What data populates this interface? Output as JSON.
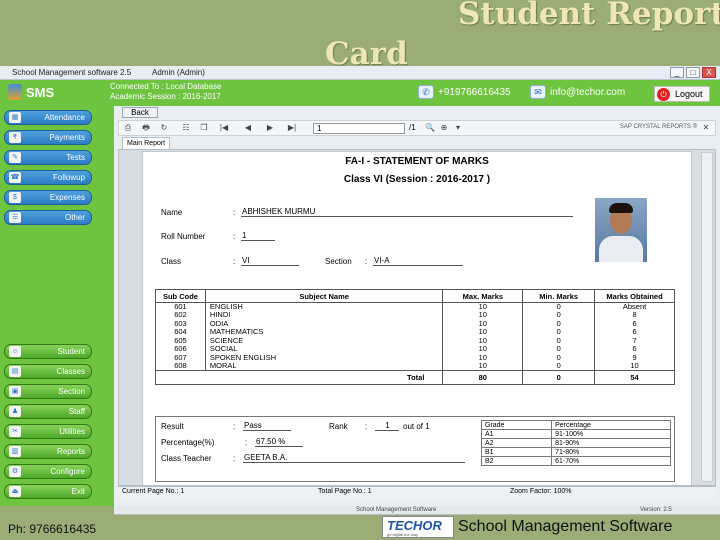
{
  "slide": {
    "title_line1": "Student Report",
    "title_line2": "Card",
    "footer_phone": "Ph: 9766616435",
    "footer_logo": "TECHOR",
    "footer_logo_tagline": "go digital the way",
    "footer_product": "School Management Software"
  },
  "window": {
    "title": "School Management software 2.5",
    "user": "Admin (Admin)",
    "btn_min": "_",
    "btn_max": "□",
    "btn_close": "X"
  },
  "header": {
    "logo_text": "SMS",
    "connection": "Connected To : Local Database",
    "session": "Academic Session : 2016-2017",
    "phone": "+919766616435",
    "email": "info@techor.com",
    "logout": "Logout"
  },
  "sidebar": {
    "top": [
      {
        "label": "Attendance",
        "icon": "calendar-icon"
      },
      {
        "label": "Payments",
        "icon": "payments-icon"
      },
      {
        "label": "Tests",
        "icon": "tests-icon"
      },
      {
        "label": "Followup",
        "icon": "followup-icon"
      },
      {
        "label": "Expenses",
        "icon": "expenses-icon"
      },
      {
        "label": "Other",
        "icon": "other-icon"
      }
    ],
    "bottom": [
      {
        "label": "Student",
        "icon": "student-icon"
      },
      {
        "label": "Classes",
        "icon": "classes-icon"
      },
      {
        "label": "Section",
        "icon": "section-icon"
      },
      {
        "label": "Staff",
        "icon": "staff-icon"
      },
      {
        "label": "Utilities",
        "icon": "utilities-icon"
      },
      {
        "label": "Reports",
        "icon": "reports-icon"
      },
      {
        "label": "Configure",
        "icon": "configure-icon"
      },
      {
        "label": "Exit",
        "icon": "exit-icon"
      }
    ]
  },
  "viewer": {
    "back": "Back",
    "page_input": "1",
    "page_count": "/1",
    "brand": "SAP CRYSTAL REPORTS ®",
    "tab": "Main Report",
    "status_current": "Current Page No.: 1",
    "status_total": "Total Page No.: 1",
    "status_zoom": "Zoom Factor: 100%"
  },
  "report": {
    "title": "FA-I  - STATEMENT OF MARKS",
    "subtitle": "Class VI (Session : 2016-2017 )",
    "name_label": "Name",
    "name": "ABHISHEK  MURMU",
    "roll_label": "Roll Number",
    "roll": "1",
    "class_label": "Class",
    "class": "VI",
    "section_label": "Section",
    "section": "VI-A",
    "colon": ":",
    "headers": [
      "Sub Code",
      "Subject Name",
      "Max. Marks",
      "Min. Marks",
      "Marks Obtained"
    ],
    "rows": [
      [
        "601",
        "ENGLISH",
        "10",
        "0",
        "Absent"
      ],
      [
        "602",
        "HINDI",
        "10",
        "0",
        "8"
      ],
      [
        "603",
        "ODIA",
        "10",
        "0",
        "6"
      ],
      [
        "604",
        "MATHEMATICS",
        "10",
        "0",
        "6"
      ],
      [
        "605",
        "SCIENCE",
        "10",
        "0",
        "7"
      ],
      [
        "606",
        "SOCIAL",
        "10",
        "0",
        "6"
      ],
      [
        "607",
        "SPOKEN ENGLISH",
        "10",
        "0",
        "9"
      ],
      [
        "608",
        "MORAL",
        "10",
        "0",
        "10"
      ]
    ],
    "total_label": "Total",
    "total_max": "80",
    "total_min": "0",
    "total_obtained": "54",
    "result_label": "Result",
    "result": "Pass",
    "rank_label": "Rank",
    "rank": "1",
    "rank_of": "out of 1",
    "percentage_label": "Percentage(%)",
    "percentage": "67.50 %",
    "teacher_label": "Class Teacher",
    "teacher": "GEETA B.A.",
    "grade_header": "Grade",
    "perc_header": "Percentage",
    "grades": [
      [
        "A1",
        "91-100%"
      ],
      [
        "A2",
        "81-90%"
      ],
      [
        "B1",
        "71-80%"
      ],
      [
        "B2",
        "61-70%"
      ]
    ]
  },
  "footer_band": {
    "left": "School Management Software",
    "right": "Version: 2.5"
  }
}
